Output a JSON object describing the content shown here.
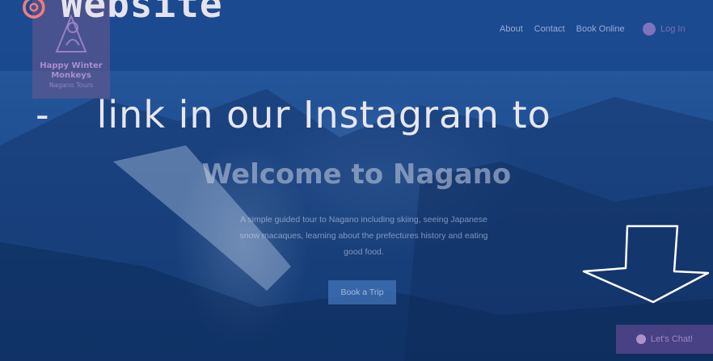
{
  "overlay": {
    "title_bullet": "◎",
    "title_text": "Website",
    "line_dash": "-",
    "line_text": "link in our Instagram to"
  },
  "logo": {
    "line1": "Happy Winter",
    "line2": "Monkeys",
    "line3": "Nagano Tours",
    "icon": "monkey-logo-icon"
  },
  "nav": {
    "items": [
      "About",
      "Contact",
      "Book Online"
    ],
    "login_label": "Log In",
    "login_icon": "avatar-icon"
  },
  "hero": {
    "title": "Welcome to Nagano",
    "description": "A simple guided tour to Nagano including skiing, seeing Japanese snow macaques, learning about the prefectures history and eating good food.",
    "button_label": "Book a Trip"
  },
  "chat": {
    "label": "Let's Chat!",
    "icon": "chat-bubble-icon"
  },
  "colors": {
    "overlay_tint": "#1e4f8f",
    "overlay_text": "#e6e3ec",
    "bullet_accent": "#f07d7d",
    "brand_purple": "#a082c8"
  }
}
